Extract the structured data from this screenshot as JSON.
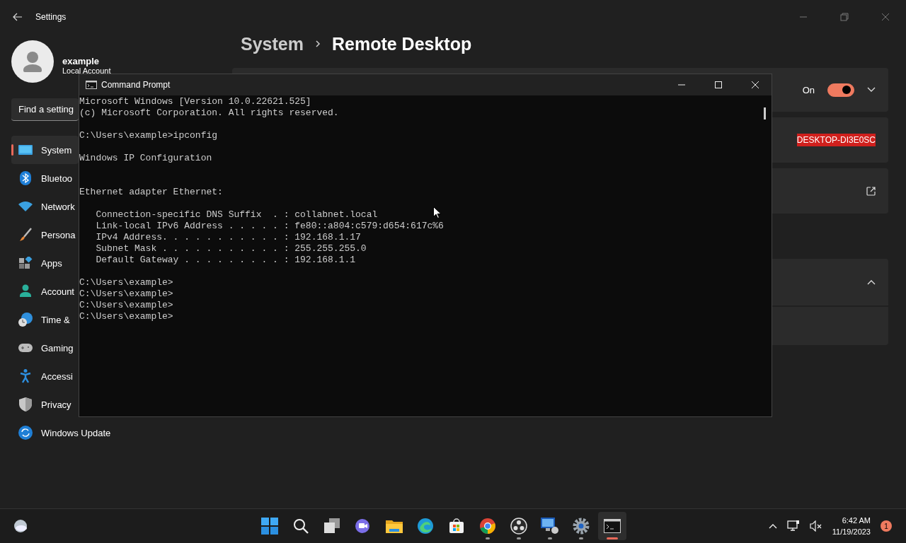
{
  "settings": {
    "title": "Settings",
    "account": {
      "name": "example",
      "type": "Local Account"
    },
    "search": {
      "placeholder": "Find a setting"
    },
    "breadcrumb": {
      "parent": "System",
      "current": "Remote Desktop"
    },
    "nav": [
      {
        "label": "System",
        "selected": true
      },
      {
        "label": "Bluetoo",
        "selected": false
      },
      {
        "label": "Network",
        "selected": false
      },
      {
        "label": "Persona",
        "selected": false
      },
      {
        "label": "Apps",
        "selected": false
      },
      {
        "label": "Account",
        "selected": false
      },
      {
        "label": "Time &",
        "selected": false
      },
      {
        "label": "Gaming",
        "selected": false
      },
      {
        "label": "Accessi",
        "selected": false
      },
      {
        "label": "Privacy",
        "selected": false
      },
      {
        "label": "Windows Update",
        "selected": false
      }
    ],
    "cards": [
      {
        "kind": "toggle",
        "value": "On",
        "on": true,
        "expanded": false
      },
      {
        "kind": "text",
        "value": "DESKTOP-DI3E0SC"
      },
      {
        "kind": "link"
      },
      {
        "kind": "expander",
        "expanded": true
      },
      {
        "kind": "blank"
      }
    ]
  },
  "cmd": {
    "title": "Command Prompt",
    "blocks": [
      {
        "lines": [
          "Microsoft Windows [Version 10.0.22621.525]",
          "(c) Microsoft Corporation. All rights reserved."
        ]
      },
      {
        "lines": [
          "C:\\Users\\example>ipconfig"
        ]
      },
      {
        "lines": [
          "Windows IP Configuration"
        ]
      },
      {
        "lines": [
          "Ethernet adapter Ethernet:"
        ]
      },
      {
        "lines": [
          "   Connection-specific DNS Suffix  . : collabnet.local",
          "   Link-local IPv6 Address . . . . . : fe80::a804:c579:d654:617c%6",
          "   IPv4 Address. . . . . . . . . . . : 192.168.1.17",
          "   Subnet Mask . . . . . . . . . . . : 255.255.255.0",
          "   Default Gateway . . . . . . . . . : 192.168.1.1"
        ]
      },
      {
        "lines": [
          "C:\\Users\\example>",
          "C:\\Users\\example>",
          "C:\\Users\\example>",
          "C:\\Users\\example>"
        ]
      }
    ]
  },
  "taskbar": {
    "apps": [
      {
        "running": false,
        "active": false
      },
      {
        "running": false,
        "active": false
      },
      {
        "running": false,
        "active": false
      },
      {
        "running": false,
        "active": false
      },
      {
        "running": false,
        "active": false
      },
      {
        "running": false,
        "active": false
      },
      {
        "running": false,
        "active": false
      },
      {
        "running": true,
        "active": false
      },
      {
        "running": true,
        "active": false
      },
      {
        "running": true,
        "active": false
      },
      {
        "running": true,
        "active": false
      },
      {
        "running": true,
        "active": true
      }
    ],
    "time": "6:42 AM",
    "date": "11/19/2023",
    "notifications": "1"
  }
}
